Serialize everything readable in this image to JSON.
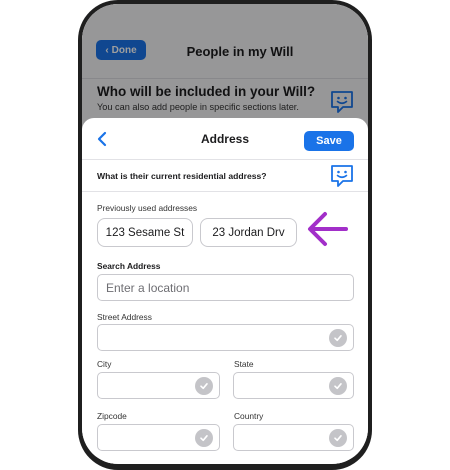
{
  "background": {
    "done_label": "Done",
    "title": "People in my Will",
    "question": "Who will be included in your Will?",
    "subtitle": "You can also add people in specific sections later."
  },
  "sheet": {
    "title": "Address",
    "save_label": "Save",
    "question": "What is their current residential address?",
    "previous_label": "Previously used addresses",
    "previous_addresses": [
      "123 Sesame St",
      "23 Jordan Drv"
    ],
    "search_label": "Search Address",
    "search_placeholder": "Enter a location",
    "street_label": "Street Address",
    "city_label": "City",
    "state_label": "State",
    "zip_label": "Zipcode",
    "country_label": "Country"
  },
  "colors": {
    "accent": "#1a73e8",
    "annotation_arrow": "#a22fc9"
  }
}
